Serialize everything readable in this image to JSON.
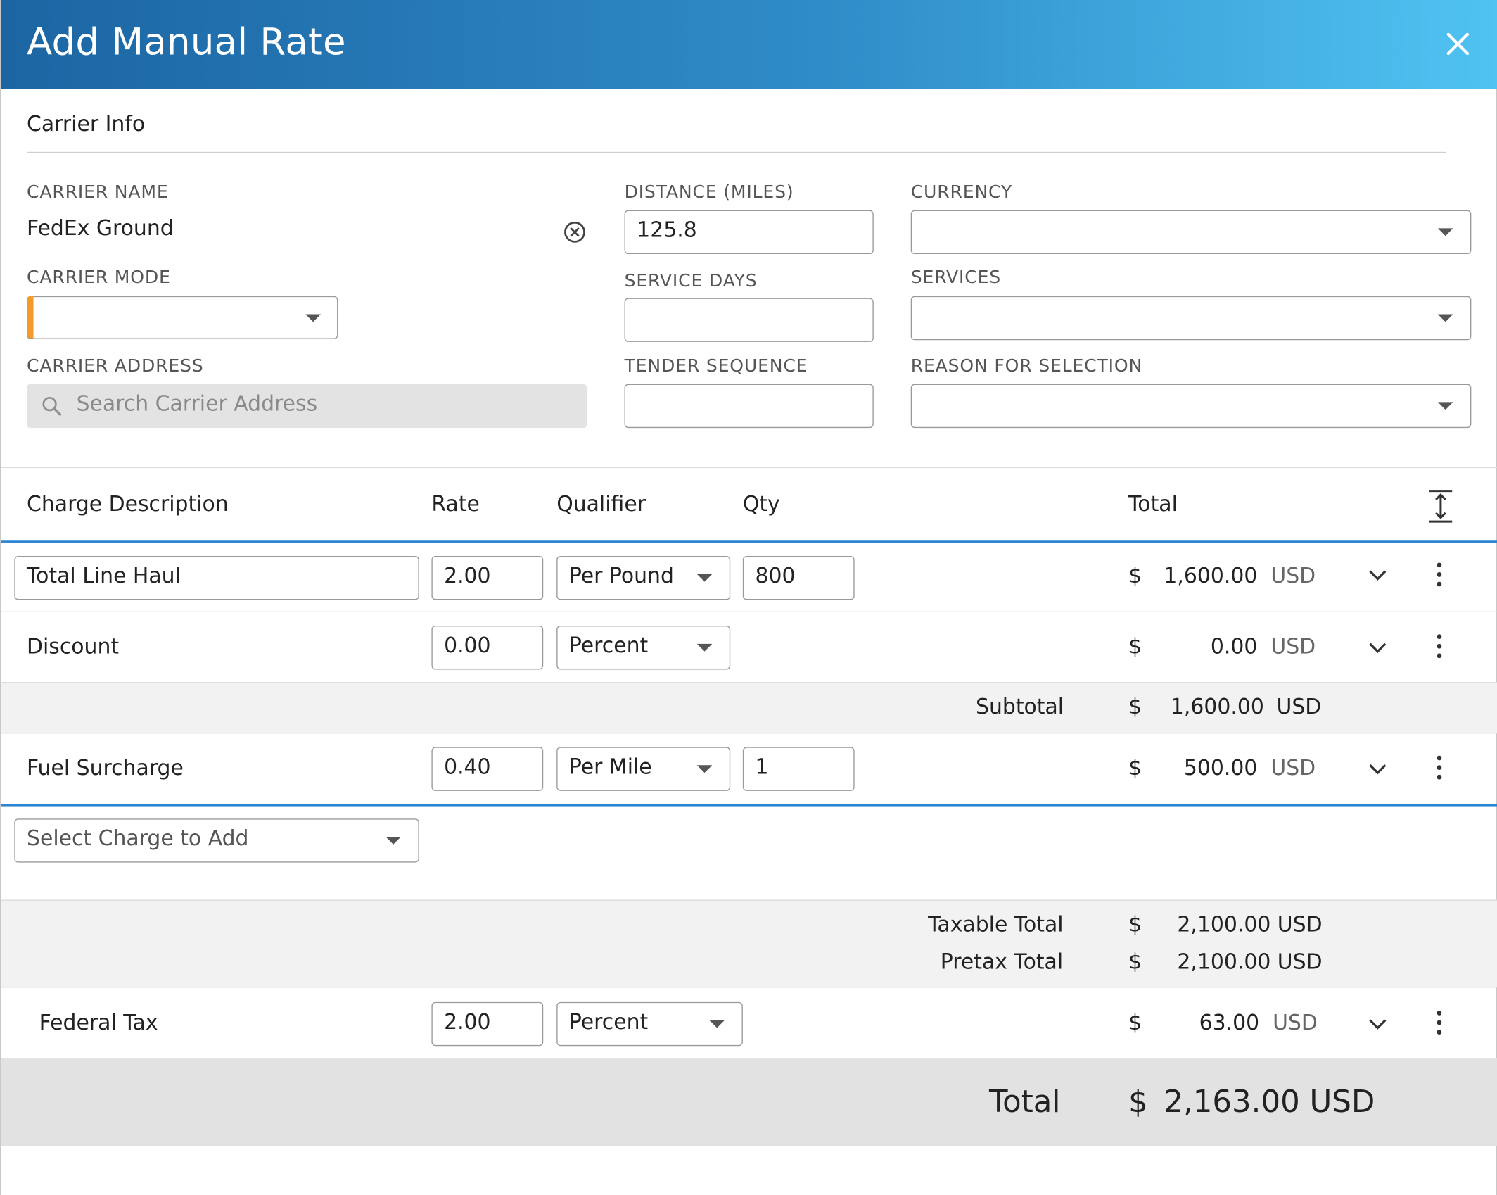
{
  "dialog": {
    "title": "Add Manual Rate"
  },
  "carrier_info": {
    "section_title": "Carrier Info",
    "carrier_name": {
      "label": "CARRIER NAME",
      "value": "FedEx Ground"
    },
    "carrier_mode": {
      "label": "CARRIER MODE",
      "value": ""
    },
    "carrier_address": {
      "label": "CARRIER ADDRESS",
      "placeholder": "Search Carrier Address"
    },
    "distance": {
      "label": "DISTANCE (MILES)",
      "value": "125.8"
    },
    "service_days": {
      "label": "SERVICE DAYS",
      "value": ""
    },
    "tender_sequence": {
      "label": "TENDER SEQUENCE",
      "value": ""
    },
    "currency": {
      "label": "CURRENCY",
      "value": ""
    },
    "services": {
      "label": "SERVICES",
      "value": ""
    },
    "reason": {
      "label": "REASON FOR SELECTION",
      "value": ""
    }
  },
  "charges": {
    "headers": {
      "description": "Charge Description",
      "rate": "Rate",
      "qualifier": "Qualifier",
      "qty": "Qty",
      "total": "Total"
    },
    "rows": [
      {
        "description": "Total Line Haul",
        "rate": "2.00",
        "qualifier": "Per Pound",
        "qty": "800",
        "currency_symbol": "$",
        "amount": "1,600.00",
        "currency": "USD"
      },
      {
        "description": "Discount",
        "rate": "0.00",
        "qualifier": "Percent",
        "currency_symbol": "$",
        "amount": "0.00",
        "currency": "USD"
      },
      {
        "description": "Fuel Surcharge",
        "rate": "0.40",
        "qualifier": "Per Mile",
        "qty": "1",
        "currency_symbol": "$",
        "amount": "500.00",
        "currency": "USD"
      }
    ],
    "subtotal": {
      "label": "Subtotal",
      "currency_symbol": "$",
      "amount": "1,600.00",
      "currency": "USD"
    },
    "add_charge_placeholder": "Select Charge to Add",
    "taxable_total": {
      "label": "Taxable Total",
      "currency_symbol": "$",
      "amount": "2,100.00 USD"
    },
    "pretax_total": {
      "label": "Pretax Total",
      "currency_symbol": "$",
      "amount": "2,100.00 USD"
    },
    "tax_row": {
      "description": "Federal Tax",
      "rate": "2.00",
      "qualifier": "Percent",
      "currency_symbol": "$",
      "amount": "63.00",
      "currency": "USD"
    },
    "grand_total": {
      "label": "Total",
      "currency_symbol": "$",
      "amount": "2,163.00 USD"
    }
  },
  "colors": {
    "header_start": "#1c65a3",
    "header_end": "#50c3f2",
    "accent_blue": "#2a84d2",
    "required_marker": "#f39a2b"
  },
  "icons": [
    "close-icon",
    "clear-circle-icon",
    "search-icon",
    "caret-down-icon",
    "expand-vertical-icon",
    "chevron-down-icon",
    "kebab-menu-icon"
  ]
}
